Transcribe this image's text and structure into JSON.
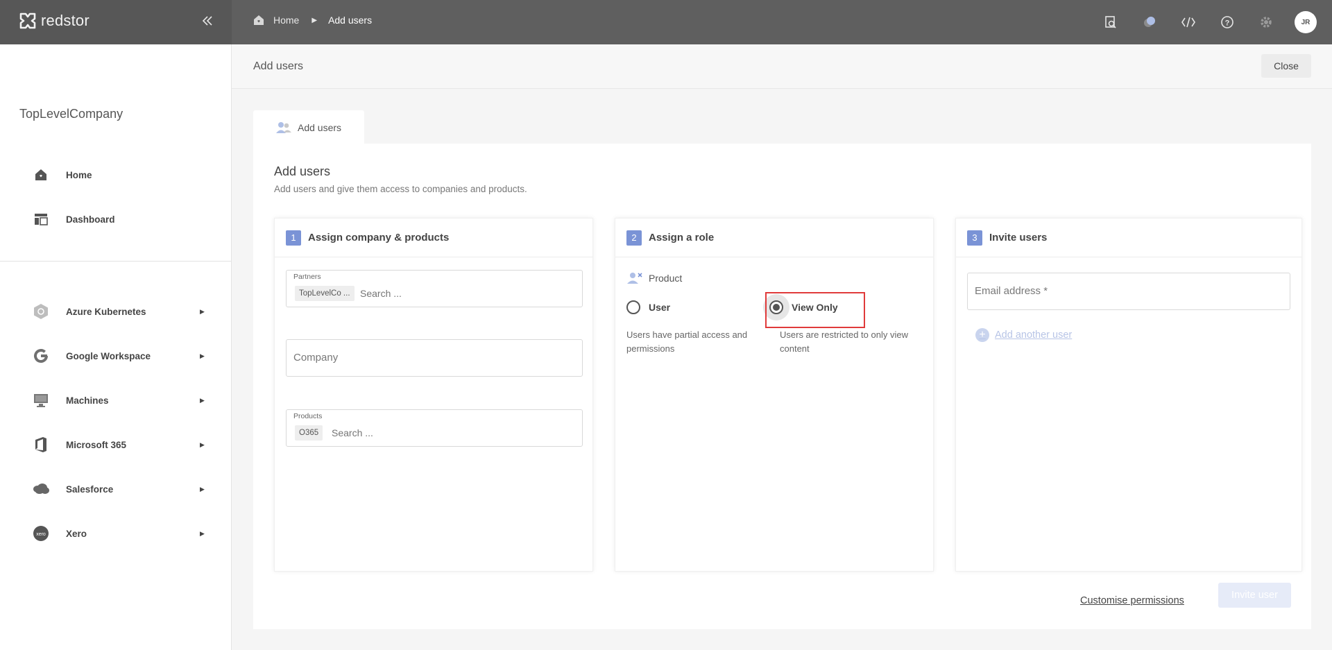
{
  "app": {
    "brand": "redstor",
    "user_initials": "JR"
  },
  "breadcrumb": {
    "home": "Home",
    "current": "Add users"
  },
  "sidebar": {
    "org": "TopLevelCompany",
    "primary": [
      {
        "label": "Home",
        "icon": "home-icon"
      },
      {
        "label": "Dashboard",
        "icon": "dashboard-icon"
      }
    ],
    "apps": [
      {
        "label": "Azure Kubernetes",
        "icon": "kubernetes-icon"
      },
      {
        "label": "Google Workspace",
        "icon": "google-icon"
      },
      {
        "label": "Machines",
        "icon": "monitor-icon"
      },
      {
        "label": "Microsoft 365",
        "icon": "office-icon"
      },
      {
        "label": "Salesforce",
        "icon": "salesforce-icon"
      },
      {
        "label": "Xero",
        "icon": "xero-icon"
      }
    ]
  },
  "page": {
    "title": "Add users",
    "close_label": "Close"
  },
  "tab": {
    "label": "Add users"
  },
  "panel": {
    "title": "Add users",
    "subtitle": "Add users and give them access to companies and products."
  },
  "step1": {
    "number": "1",
    "title": "Assign company & products",
    "partners_label": "Partners",
    "partners_chip": "TopLevelCo ...",
    "partners_search": "Search ...",
    "company_placeholder": "Company",
    "products_label": "Products",
    "products_chip": "O365",
    "products_search": "Search ..."
  },
  "step2": {
    "number": "2",
    "title": "Assign a role",
    "product_label": "Product",
    "options": [
      {
        "label": "User",
        "desc": "Users have partial access and permissions",
        "selected": false
      },
      {
        "label": "View Only",
        "desc": "Users are restricted to only view content",
        "selected": true
      }
    ]
  },
  "step3": {
    "number": "3",
    "title": "Invite users",
    "email_placeholder": "Email address *",
    "add_another": "Add another user"
  },
  "footer": {
    "customise": "Customise permissions",
    "invite": "Invite user"
  },
  "colors": {
    "accent": "#7a93d6",
    "highlight": "#e03a3a",
    "topbar": "#5f5f5f"
  }
}
